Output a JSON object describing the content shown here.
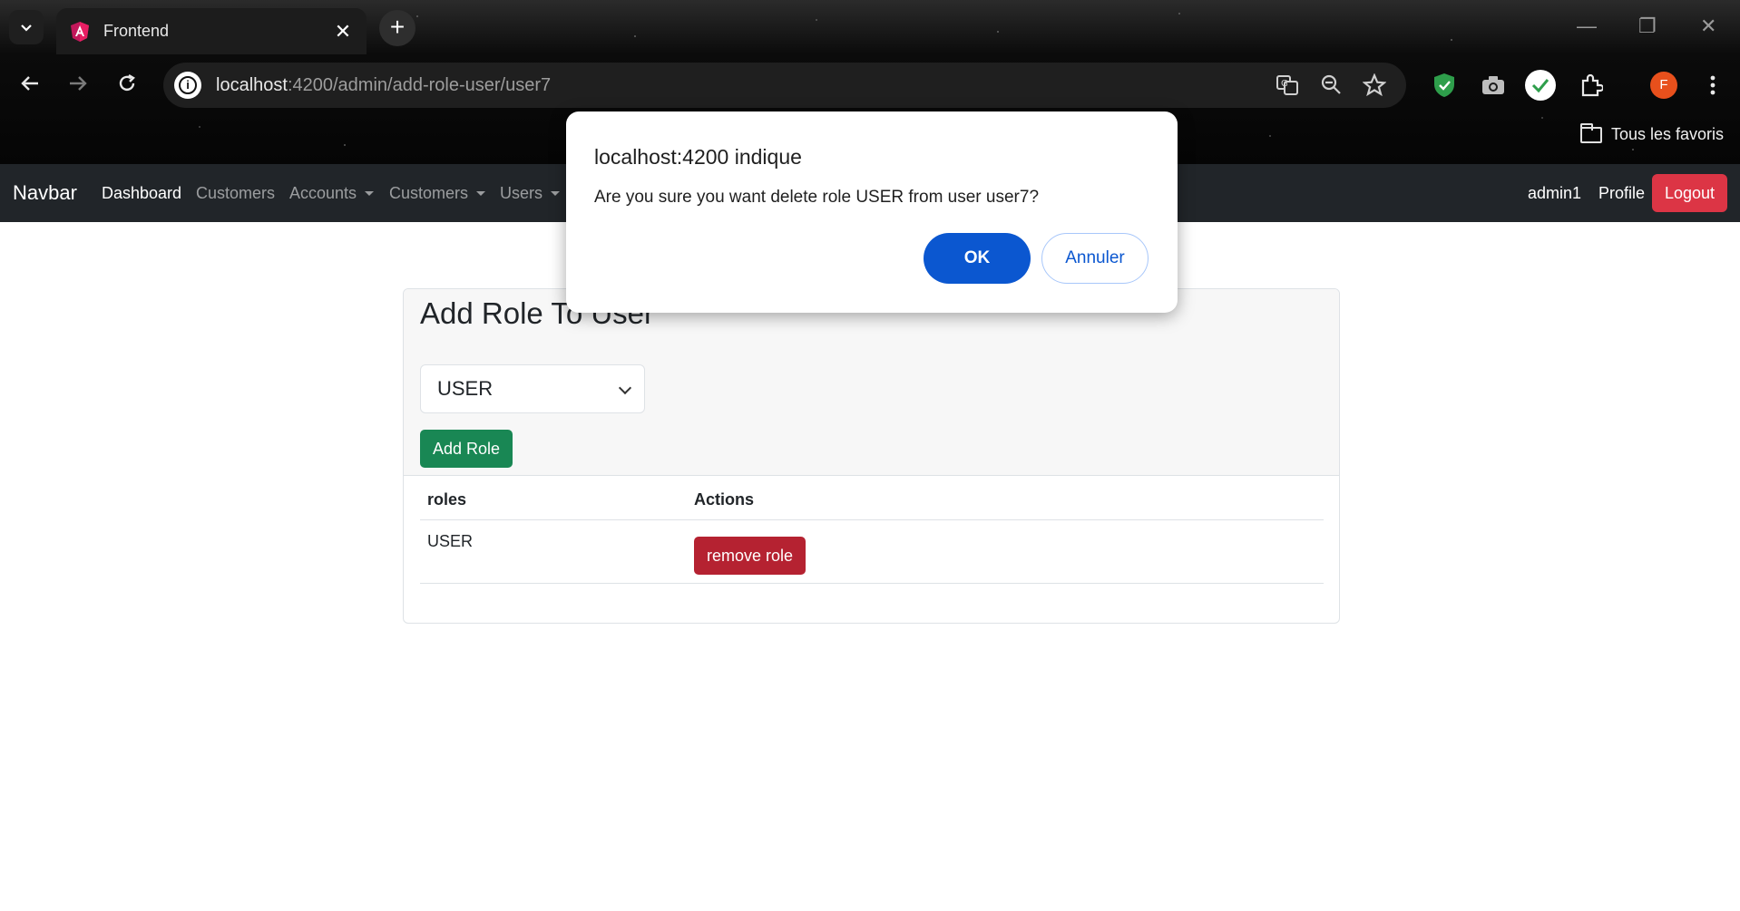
{
  "browser": {
    "tab_title": "Frontend",
    "new_tab_symbol": "+",
    "tab_close_symbol": "✕",
    "url_host": "localhost",
    "url_rest": ":4200/admin/add-role-user/user7",
    "bookmarks_all": "Tous les favoris",
    "profile_initial": "F",
    "icons": [
      "tab-search-icon",
      "back-icon",
      "forward-icon",
      "reload-icon",
      "site-info-icon",
      "translate-icon",
      "zoom-icon",
      "bookmark-star-icon",
      "shield-extension-icon",
      "camera-extension-icon",
      "check-extension-icon",
      "extensions-icon",
      "profile-avatar",
      "menu-icon",
      "folder-icon"
    ]
  },
  "navbar": {
    "brand": "Navbar",
    "links": [
      {
        "label": "Dashboard"
      },
      {
        "label": "Customers"
      },
      {
        "label": "Accounts"
      },
      {
        "label": "Customers"
      },
      {
        "label": "Users"
      }
    ],
    "username": "admin1",
    "profile": "Profile",
    "logout": "Logout"
  },
  "card": {
    "title": "Add Role To User",
    "selected_role": "USER",
    "add_role_label": "Add Role",
    "table": {
      "headers": [
        "roles",
        "Actions"
      ],
      "rows": [
        {
          "role": "USER",
          "action": "remove role"
        }
      ]
    }
  },
  "dialog": {
    "title": "localhost:4200 indique",
    "message": "Are you sure you want delete role USER from user user7?",
    "ok": "OK",
    "cancel": "Annuler"
  },
  "colors": {
    "navbar_bg": "#212529",
    "logout_bg": "#dc3545",
    "add_role_bg": "#198754",
    "remove_role_bg": "#b52231",
    "dialog_ok_bg": "#0b57d0"
  }
}
